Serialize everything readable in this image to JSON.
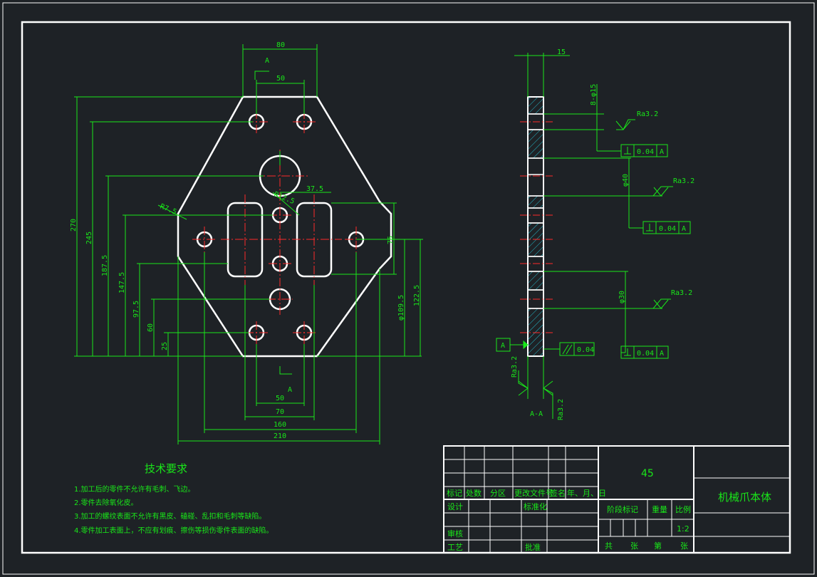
{
  "front_view": {
    "dims": {
      "d80": "80",
      "dA_top": "A",
      "d50_top": "50",
      "d270": "270",
      "d245": "245",
      "d187": "187.5",
      "d147": "147.5",
      "d97": "97.5",
      "d60": "60",
      "d25": "25",
      "dR7": "R7.5",
      "dR12": "R12.5",
      "d37": "37.5",
      "d75": "75",
      "d109": "φ109.5",
      "d122": "122.5",
      "dA_bot": "A",
      "d50_bot": "50",
      "d70": "70",
      "d160": "160",
      "d210": "210"
    }
  },
  "section_view": {
    "dims": {
      "d15": "15",
      "holes": "8-φ15",
      "ra1": "Ra3.2",
      "tol1": "0.04",
      "datum1": "A",
      "d40": "φ40",
      "ra2": "Ra3.2",
      "tol2": "0.04",
      "datum2": "A",
      "d30": "φ30",
      "ra3": "Ra3.2",
      "tol3": "0.04",
      "datum3": "A",
      "datum_box": "A",
      "par_tol": "0.04",
      "ra_left": "Ra3.2",
      "ra_right": "Ra3.2",
      "section_label": "A-A"
    }
  },
  "tech_requirements": {
    "title": "技术要求",
    "items": [
      "1.加工后的零件不允许有毛刺、飞边。",
      "2.零件去除氧化皮。",
      "3.加工的螺纹表面不允许有黑皮、磕碰、乱扣和毛刺等缺陷。",
      "4.零件加工表面上，不应有划痕、擦伤等损伤零件表面的缺陷。"
    ]
  },
  "title_block": {
    "material": "45",
    "part_name": "机械爪本体",
    "headers": [
      "标记",
      "处数",
      "分区",
      "更改文件号",
      "签名",
      "年、月、日"
    ],
    "design": "设计",
    "standard": "标准化",
    "review": "审核",
    "process": "工艺",
    "approve": "批准",
    "stage_mark": "阶段标记",
    "weight": "重量",
    "scale_label": "比例",
    "scale_value": "1:2",
    "sheets": [
      "共",
      "张",
      "第",
      "张"
    ]
  }
}
